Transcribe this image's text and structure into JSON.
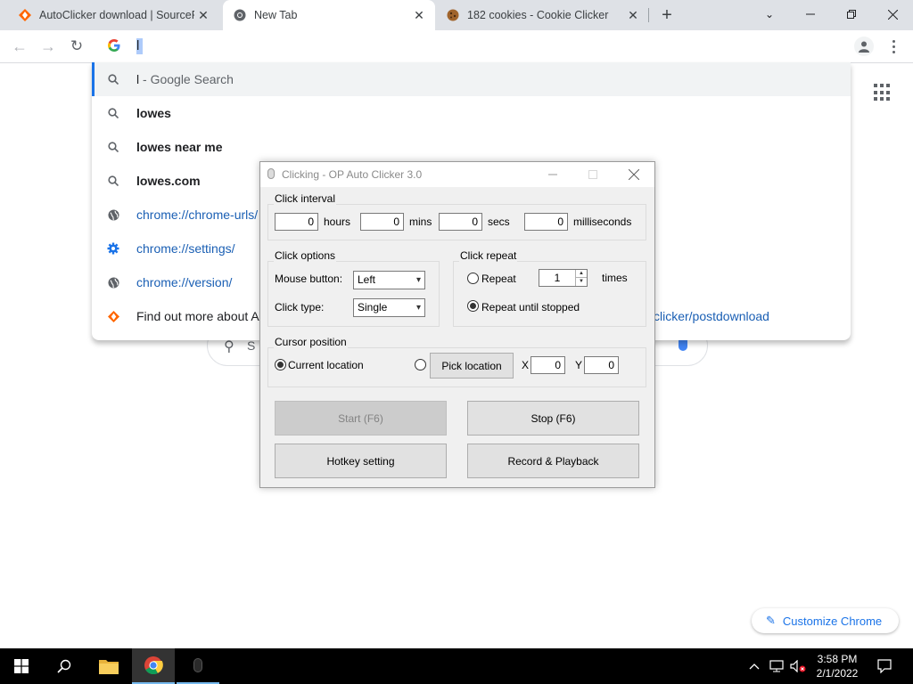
{
  "tabs": [
    {
      "title": "AutoClicker download | SourceFo",
      "icon": "sourceforge-icon"
    },
    {
      "title": "New Tab",
      "icon": "chrome-icon"
    },
    {
      "title": "182 cookies - Cookie Clicker",
      "icon": "cookie-icon"
    }
  ],
  "omnibox": {
    "value": "l"
  },
  "suggestions": [
    {
      "text_bold": "l",
      "text_rest": " - Google Search",
      "icon": "search-icon"
    },
    {
      "text_bold": "lowes",
      "text_rest": "",
      "icon": "search-icon"
    },
    {
      "text_bold": "lowes near me",
      "text_rest": "",
      "icon": "search-icon"
    },
    {
      "text_bold": "lowes.com",
      "text_rest": "",
      "icon": "search-icon"
    },
    {
      "text": "chrome://chrome-urls/",
      "icon": "globe-icon"
    },
    {
      "text": "chrome://settings/",
      "icon": "gear-icon"
    },
    {
      "text": "chrome://version/",
      "icon": "globe-icon"
    },
    {
      "text": "Find out more about A",
      "icon": "sourceforge-icon"
    }
  ],
  "ntp": {
    "postdownload_link": "clicker/postdownload",
    "search_placeholder": "S",
    "customize_label": "Customize Chrome"
  },
  "dialog": {
    "title": "Clicking - OP Auto Clicker 3.0",
    "click_interval": {
      "label": "Click interval",
      "hours_value": "0",
      "hours_label": "hours",
      "mins_value": "0",
      "mins_label": "mins",
      "secs_value": "0",
      "secs_label": "secs",
      "ms_value": "0",
      "ms_label": "milliseconds"
    },
    "click_options": {
      "label": "Click options",
      "mouse_button_label": "Mouse button:",
      "mouse_button_value": "Left",
      "click_type_label": "Click type:",
      "click_type_value": "Single"
    },
    "click_repeat": {
      "label": "Click repeat",
      "repeat_label": "Repeat",
      "repeat_count": "1",
      "times_label": "times",
      "until_stopped_label": "Repeat until stopped",
      "selected": "until_stopped"
    },
    "cursor_position": {
      "label": "Cursor position",
      "current_location_label": "Current location",
      "pick_location_label": "Pick location",
      "x_label": "X",
      "x_value": "0",
      "y_label": "Y",
      "y_value": "0",
      "selected": "current"
    },
    "buttons": {
      "start": "Start (F6)",
      "stop": "Stop (F6)",
      "hotkey": "Hotkey setting",
      "record": "Record & Playback"
    }
  },
  "taskbar": {
    "time": "3:58 PM",
    "date": "2/1/2022"
  },
  "colors": {
    "tabstrip": "#dee1e6",
    "link": "#1a5fb4",
    "accent": "#1a73e8",
    "taskbar": "#000000"
  }
}
